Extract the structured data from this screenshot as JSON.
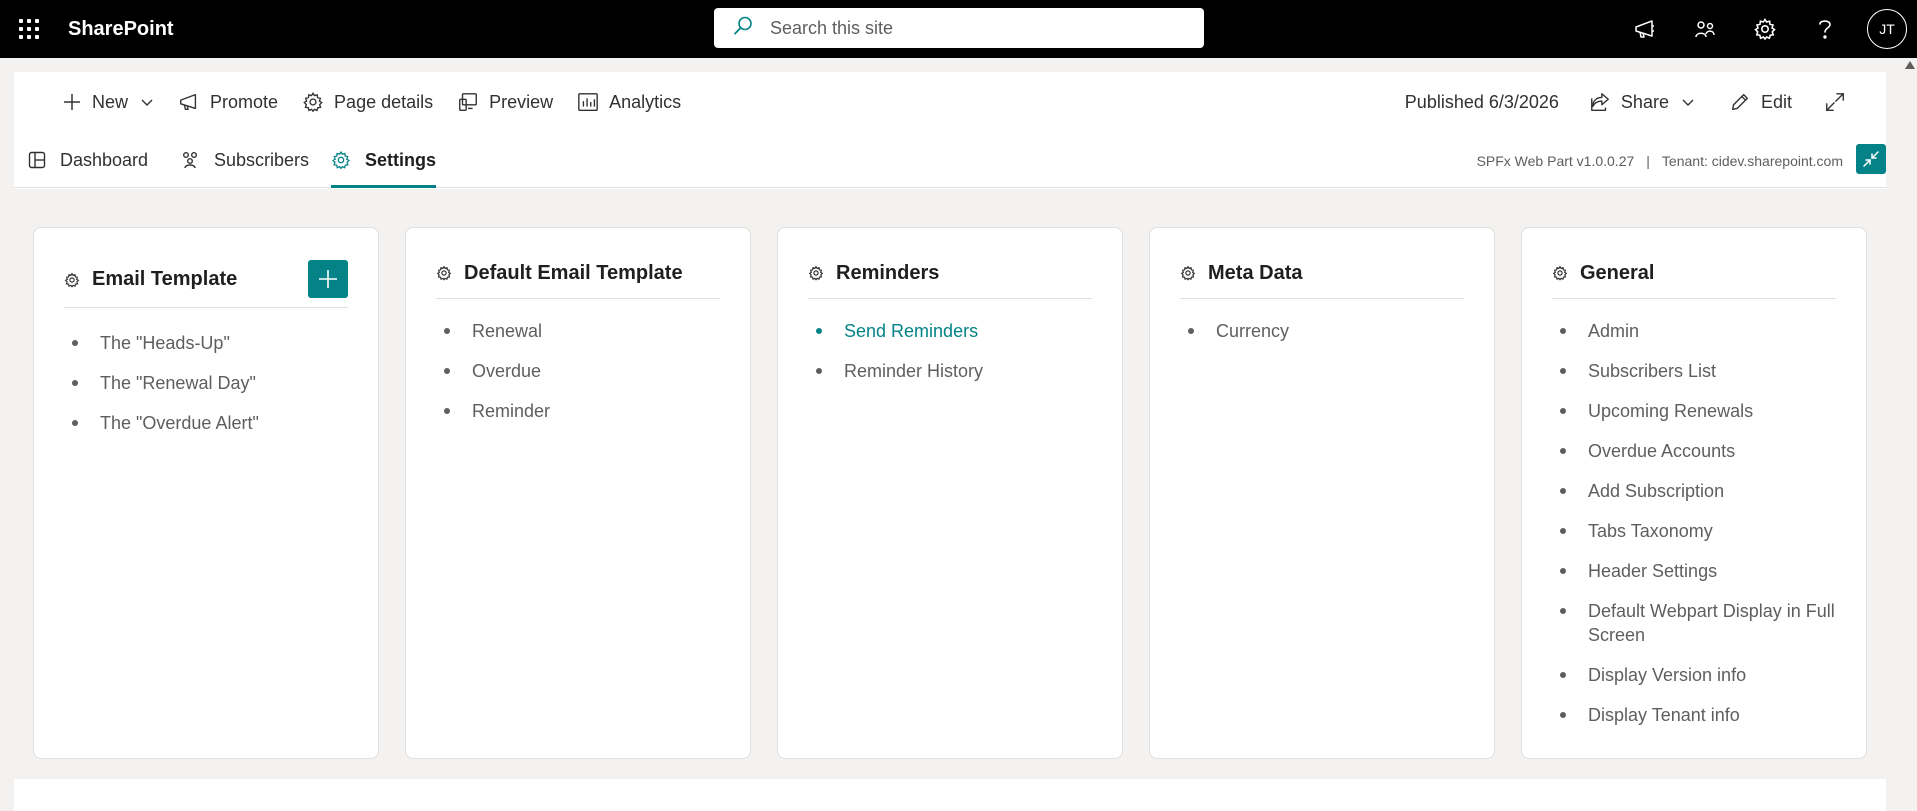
{
  "suitebar": {
    "app_name": "SharePoint",
    "search_placeholder": "Search this site",
    "avatar_initials": "JT"
  },
  "commandbar": {
    "new_label": "New",
    "promote_label": "Promote",
    "page_details_label": "Page details",
    "preview_label": "Preview",
    "analytics_label": "Analytics",
    "published_label": "Published 6/3/2026",
    "share_label": "Share",
    "edit_label": "Edit"
  },
  "tabs": [
    {
      "label": "Dashboard",
      "icon": "dashboard-icon"
    },
    {
      "label": "Subscribers",
      "icon": "people-icon"
    },
    {
      "label": "Settings",
      "icon": "gear-icon",
      "active": true
    }
  ],
  "info": {
    "version": "SPFx Web Part v1.0.0.27",
    "separator": "|",
    "tenant": "Tenant: cidev.sharepoint.com"
  },
  "accent_color": "#038387",
  "cards": [
    {
      "title": "Email Template",
      "has_add_button": true,
      "items": [
        "The \"Heads-Up\"",
        "The \"Renewal Day\"",
        "The \"Overdue Alert\""
      ]
    },
    {
      "title": "Default Email Template",
      "items": [
        "Renewal",
        "Overdue",
        "Reminder"
      ]
    },
    {
      "title": "Reminders",
      "items": [
        "Send Reminders",
        "Reminder History"
      ],
      "active_item": "Send Reminders"
    },
    {
      "title": "Meta Data",
      "items": [
        "Currency"
      ]
    },
    {
      "title": "General",
      "items": [
        "Admin",
        "Subscribers List",
        "Upcoming Renewals",
        "Overdue Accounts",
        "Add Subscription",
        "Tabs Taxonomy",
        "Header Settings",
        "Default Webpart Display in Full Screen",
        "Display Version info",
        "Display Tenant info"
      ]
    }
  ]
}
